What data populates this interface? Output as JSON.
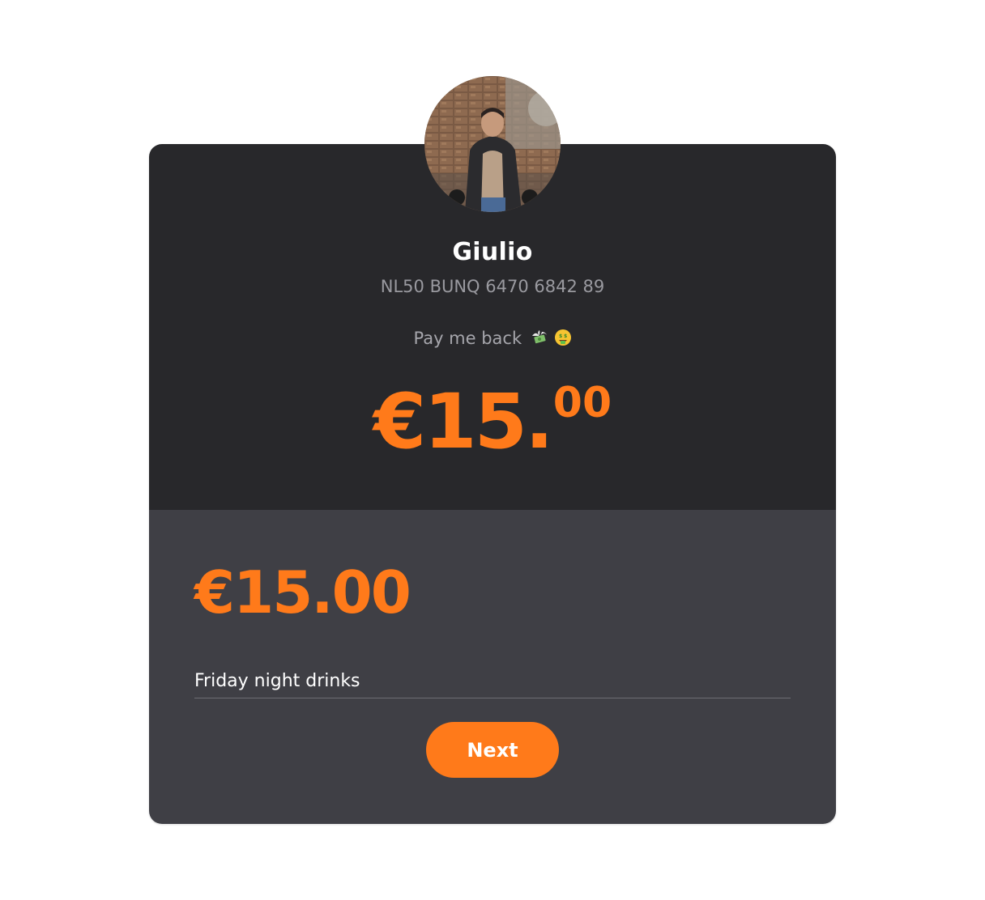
{
  "profile": {
    "name": "Giulio",
    "iban": "NL50 BUNQ 6470 6842 89",
    "description": "Pay me back",
    "description_emojis": [
      "money-with-wings-icon",
      "money-mouth-face-icon"
    ]
  },
  "request": {
    "amount_main": "€15.",
    "amount_cents": "00"
  },
  "form": {
    "amount_value": "€15.00",
    "description_value": "Friday night drinks",
    "next_label": "Next"
  },
  "colors": {
    "accent": "#ff7a1a",
    "card_top": "#28282b",
    "card_bottom": "#3f3f45",
    "muted_text": "#9a9aa0"
  }
}
